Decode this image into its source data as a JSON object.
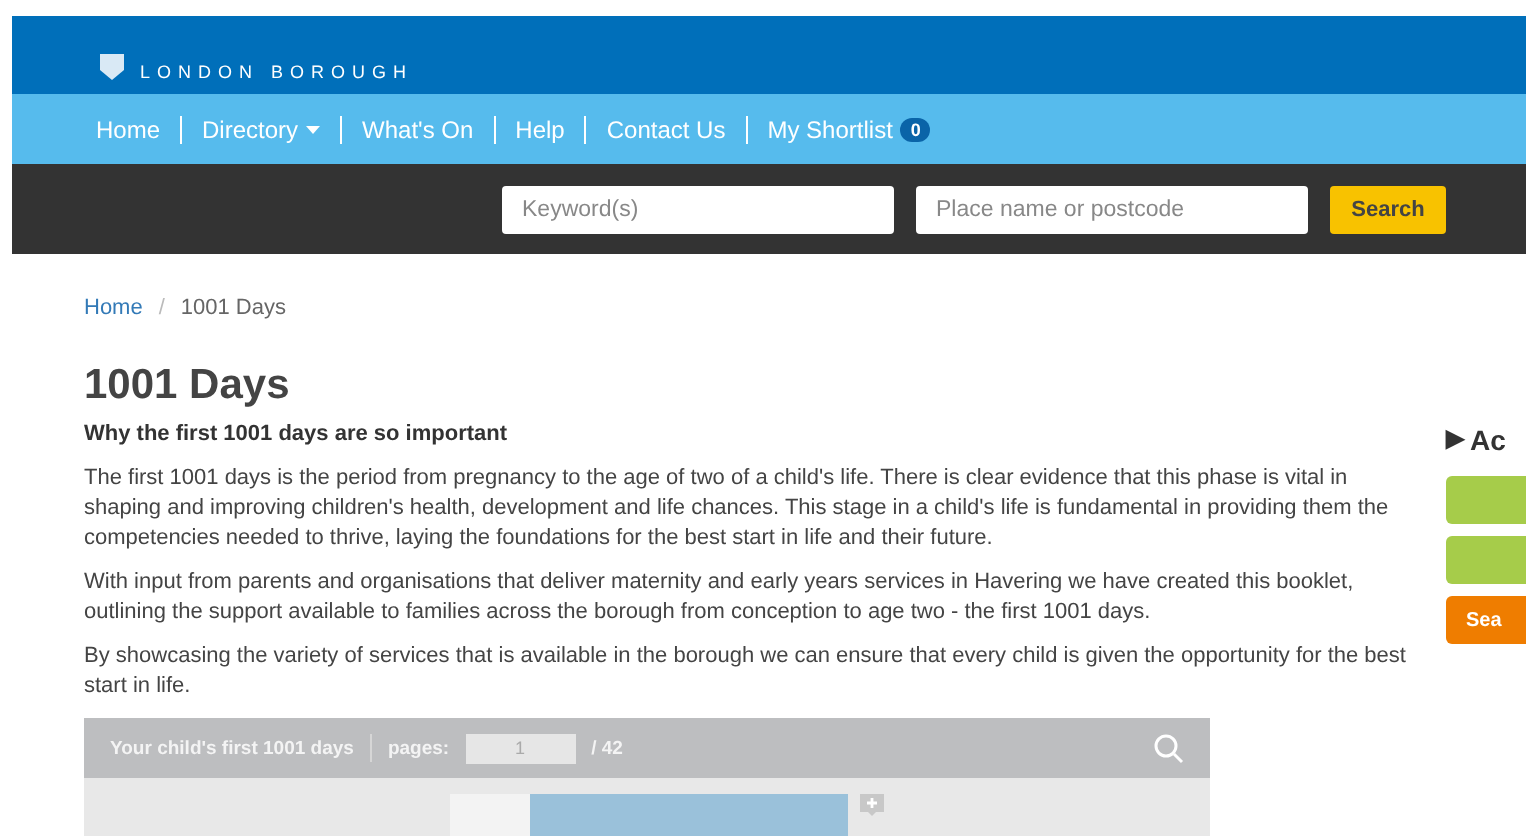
{
  "header": {
    "subtitle": "LONDON BOROUGH"
  },
  "nav": [
    {
      "label": "Home",
      "dropdown": false
    },
    {
      "label": "Directory",
      "dropdown": true
    },
    {
      "label": "What's On",
      "dropdown": false
    },
    {
      "label": "Help",
      "dropdown": false
    },
    {
      "label": "Contact Us",
      "dropdown": false
    },
    {
      "label": "My Shortlist",
      "dropdown": false,
      "badge": "0"
    }
  ],
  "search": {
    "keyword_placeholder": "Keyword(s)",
    "place_placeholder": "Place name or postcode",
    "button": "Search"
  },
  "breadcrumb_separator": "/",
  "breadcrumb": [
    {
      "label": "Home",
      "link": true
    },
    {
      "label": "1001 Days",
      "link": false
    }
  ],
  "title": "1001 Days",
  "subtitle": "Why the first 1001 days are so important",
  "paragraphs": [
    "The first 1001 days is the period from pregnancy to the age of two of a child's life. There is clear evidence that this phase is vital in shaping and improving children's health, development and life chances. This stage in a child's life is fundamental in providing them the competencies needed to thrive, laying the foundations for the best start in life and their future.",
    "With input from parents and organisations that deliver maternity and early years services in Havering we have created this booklet, outlining the support available to families across the borough from conception to age two - the first 1001 days.",
    "By showcasing the variety of services that is available in the borough we can ensure that every child is given the opportunity for the best start in life."
  ],
  "viewer": {
    "title": "Your child's first 1001 days",
    "pages_label": "pages:",
    "page": "1",
    "total": "/ 42"
  },
  "sidebar": {
    "heading_marker": "▶",
    "heading": "Ac",
    "buttons": [
      {
        "kind": "green"
      },
      {
        "kind": "green"
      },
      {
        "kind": "orange",
        "label": "Sea"
      }
    ]
  }
}
